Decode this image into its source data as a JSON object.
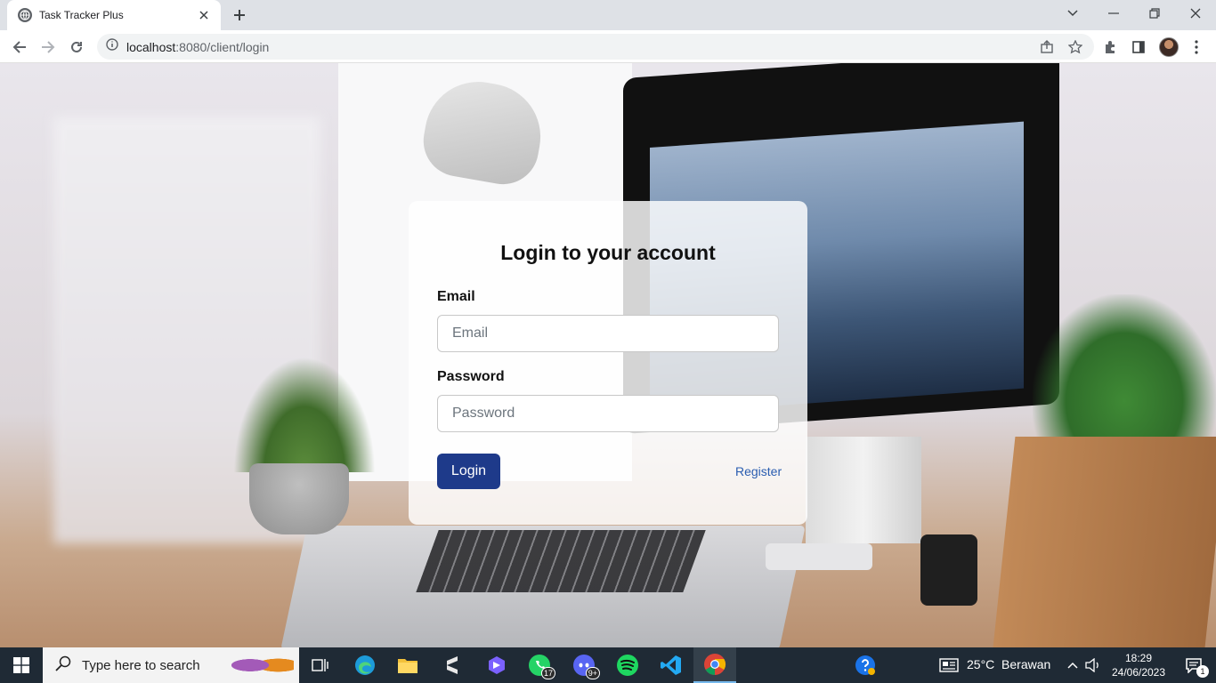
{
  "browser": {
    "tab_title": "Task Tracker Plus",
    "url_host": "localhost",
    "url_path": ":8080/client/login"
  },
  "login": {
    "heading": "Login to your account",
    "email_label": "Email",
    "email_placeholder": "Email",
    "email_value": "",
    "password_label": "Password",
    "password_placeholder": "Password",
    "password_value": "",
    "login_button": "Login",
    "register_link": "Register"
  },
  "taskbar": {
    "search_placeholder": "Type here to search",
    "whatsapp_badge": "17",
    "discord_badge": "9+",
    "weather": "25°C  Berawan",
    "time": "18:29",
    "date": "24/06/2023",
    "notification_count": "1"
  },
  "colors": {
    "primary_button": "#1e3a8a",
    "link": "#2a5db0",
    "taskbar": "#1f2a35"
  }
}
